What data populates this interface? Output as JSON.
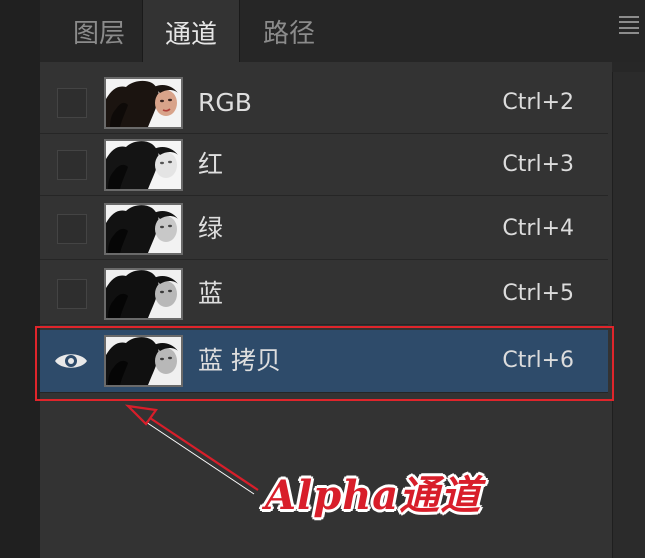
{
  "tabs": [
    {
      "label": "图层",
      "active": false
    },
    {
      "label": "通道",
      "active": true
    },
    {
      "label": "路径",
      "active": false
    }
  ],
  "channels": [
    {
      "name": "RGB",
      "shortcut": "Ctrl+2",
      "visible": false,
      "selected": false,
      "thumb": "color"
    },
    {
      "name": "红",
      "shortcut": "Ctrl+3",
      "visible": false,
      "selected": false,
      "thumb": "gray"
    },
    {
      "name": "绿",
      "shortcut": "Ctrl+4",
      "visible": false,
      "selected": false,
      "thumb": "gray"
    },
    {
      "name": "蓝",
      "shortcut": "Ctrl+5",
      "visible": false,
      "selected": false,
      "thumb": "gray"
    },
    {
      "name": "蓝 拷贝",
      "shortcut": "Ctrl+6",
      "visible": true,
      "selected": true,
      "thumb": "gray"
    }
  ],
  "annotation": {
    "text": "Alpha通道",
    "color": "#d81e2a"
  },
  "icons": {
    "menu": "panel-menu-icon",
    "visibility": "eye-icon"
  },
  "colors": {
    "selected_row": "#2e4b6a",
    "highlight_border": "#e0252b"
  }
}
